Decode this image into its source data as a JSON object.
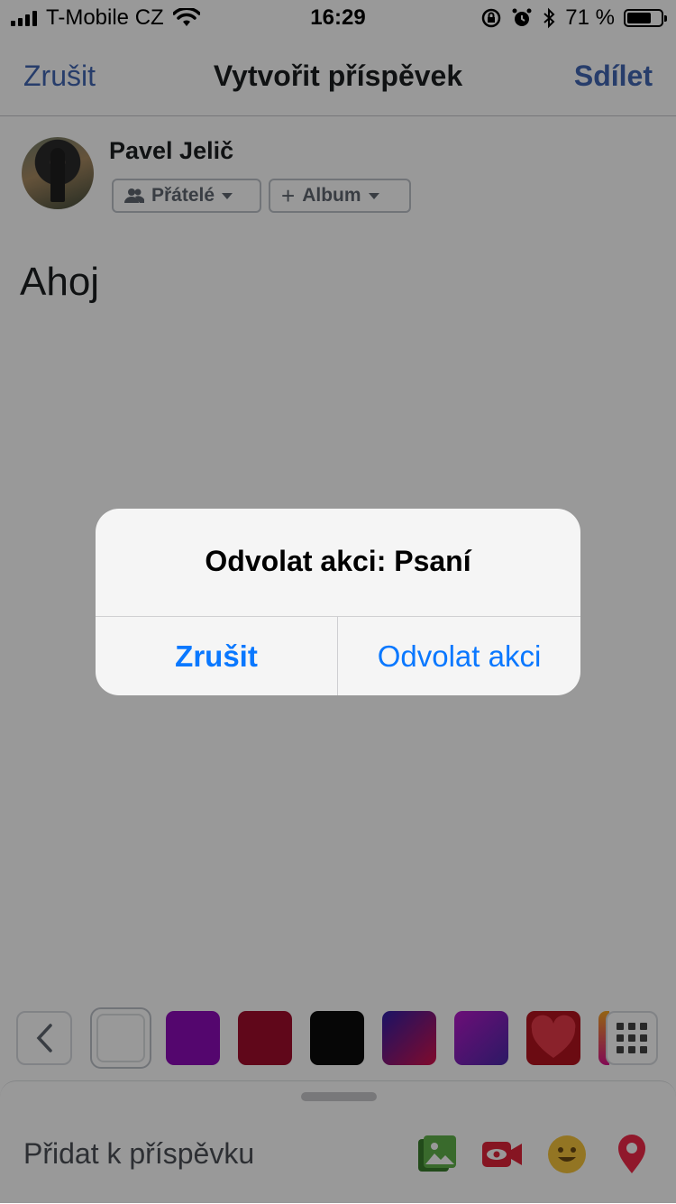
{
  "status_bar": {
    "carrier": "T-Mobile CZ",
    "time": "16:29",
    "battery_text": "71 %",
    "battery_level": 0.71,
    "icons": [
      "signal-icon",
      "wifi-icon",
      "rotation-lock-icon",
      "alarm-icon",
      "bluetooth-icon",
      "battery-icon"
    ]
  },
  "nav": {
    "cancel_label": "Zrušit",
    "title": "Vytvořit příspěvek",
    "share_label": "Sdílet"
  },
  "author": {
    "name": "Pavel Jelič",
    "audience_label": "Přátelé",
    "album_label": "Album"
  },
  "post": {
    "text": "Ahoj"
  },
  "backgrounds": {
    "swatch_colors": [
      "#8d0bb8",
      "#a00d2c",
      "#0a0a0a",
      "gradient-purple-red",
      "gradient-violet",
      "heart"
    ]
  },
  "sheet": {
    "add_label": "Přidat k příspěvku",
    "icons": [
      "photo-icon",
      "live-video-icon",
      "feeling-icon",
      "checkin-icon"
    ]
  },
  "alert": {
    "message": "Odvolat akci: Psaní",
    "cancel_label": "Zrušit",
    "undo_label": "Odvolat akci"
  },
  "colors": {
    "accent": "#4267b2",
    "ios_blue": "#0a78ff"
  }
}
